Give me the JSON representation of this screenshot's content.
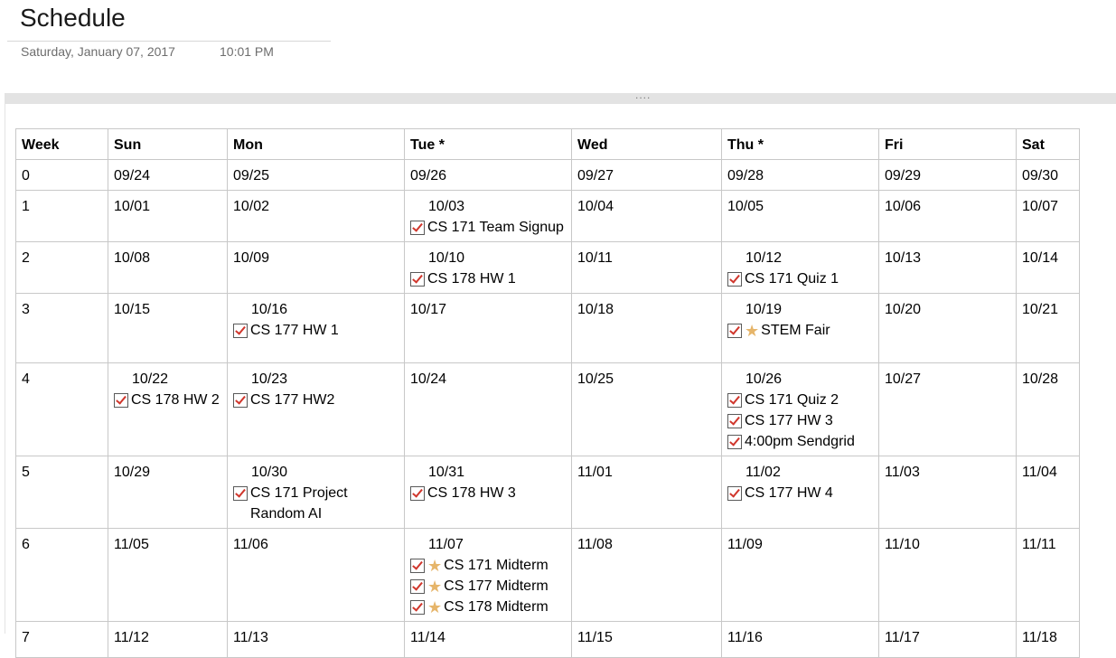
{
  "header": {
    "title": "Schedule",
    "date": "Saturday, January 07, 2017",
    "time": "10:01 PM"
  },
  "resize_handle": "....",
  "columns": [
    "Week",
    "Sun",
    "Mon",
    "Tue *",
    "Wed",
    "Thu *",
    "Fri",
    "Sat"
  ],
  "weeks": [
    {
      "week": "0",
      "days": [
        {
          "date": "09/24"
        },
        {
          "date": "09/25"
        },
        {
          "date": "09/26"
        },
        {
          "date": "09/27"
        },
        {
          "date": "09/28"
        },
        {
          "date": "09/29"
        },
        {
          "date": "09/30"
        }
      ]
    },
    {
      "week": "1",
      "days": [
        {
          "date": "10/01"
        },
        {
          "date": "10/02"
        },
        {
          "date": "10/03",
          "tasks": [
            {
              "text": "CS 171 Team Signup",
              "checked": true
            }
          ]
        },
        {
          "date": "10/04"
        },
        {
          "date": "10/05"
        },
        {
          "date": "10/06"
        },
        {
          "date": "10/07"
        }
      ]
    },
    {
      "week": "2",
      "days": [
        {
          "date": "10/08"
        },
        {
          "date": "10/09"
        },
        {
          "date": "10/10",
          "tasks": [
            {
              "text": "CS 178 HW 1",
              "checked": true
            }
          ]
        },
        {
          "date": "10/11"
        },
        {
          "date": "10/12",
          "tasks": [
            {
              "text": "CS 171 Quiz 1",
              "checked": true
            }
          ]
        },
        {
          "date": "10/13"
        },
        {
          "date": "10/14"
        }
      ]
    },
    {
      "week": "3",
      "days": [
        {
          "date": "10/15"
        },
        {
          "date": "10/16",
          "tasks": [
            {
              "text": "CS 177 HW 1",
              "checked": true
            }
          ]
        },
        {
          "date": "10/17"
        },
        {
          "date": "10/18"
        },
        {
          "date": "10/19",
          "tasks": [
            {
              "text": "STEM Fair",
              "checked": true,
              "star": true
            }
          ]
        },
        {
          "date": "10/20"
        },
        {
          "date": "10/21"
        }
      ]
    },
    {
      "week": "4",
      "days": [
        {
          "date": "10/22",
          "tasks": [
            {
              "text": "CS 178 HW 2",
              "checked": true
            }
          ]
        },
        {
          "date": "10/23",
          "tasks": [
            {
              "text": "CS 177 HW2",
              "checked": true
            }
          ]
        },
        {
          "date": "10/24"
        },
        {
          "date": "10/25"
        },
        {
          "date": "10/26",
          "tasks": [
            {
              "text": "CS 171 Quiz 2",
              "checked": true
            },
            {
              "text": "CS 177 HW 3",
              "checked": true
            },
            {
              "text": "4:00pm Sendgrid",
              "checked": true
            }
          ]
        },
        {
          "date": "10/27"
        },
        {
          "date": "10/28"
        }
      ]
    },
    {
      "week": "5",
      "days": [
        {
          "date": "10/29"
        },
        {
          "date": "10/30",
          "tasks": [
            {
              "text": "CS 171 Project Random AI",
              "checked": true,
              "multiline": true
            }
          ]
        },
        {
          "date": "10/31",
          "tasks": [
            {
              "text": "CS 178 HW 3",
              "checked": true
            }
          ]
        },
        {
          "date": "11/01"
        },
        {
          "date": "11/02",
          "tasks": [
            {
              "text": "CS 177 HW 4",
              "checked": true
            }
          ]
        },
        {
          "date": "11/03"
        },
        {
          "date": "11/04"
        }
      ]
    },
    {
      "week": "6",
      "days": [
        {
          "date": "11/05"
        },
        {
          "date": "11/06"
        },
        {
          "date": "11/07",
          "tasks": [
            {
              "text": "CS 171 Midterm",
              "checked": true,
              "star": true
            },
            {
              "text": "CS 177 Midterm",
              "checked": true,
              "star": true
            },
            {
              "text": "CS 178 Midterm",
              "checked": true,
              "star": true
            }
          ]
        },
        {
          "date": "11/08"
        },
        {
          "date": "11/09"
        },
        {
          "date": "11/10"
        },
        {
          "date": "11/11"
        }
      ]
    },
    {
      "week": "7",
      "days": [
        {
          "date": "11/12"
        },
        {
          "date": "11/13"
        },
        {
          "date": "11/14"
        },
        {
          "date": "11/15"
        },
        {
          "date": "11/16"
        },
        {
          "date": "11/17"
        },
        {
          "date": "11/18"
        }
      ]
    }
  ]
}
